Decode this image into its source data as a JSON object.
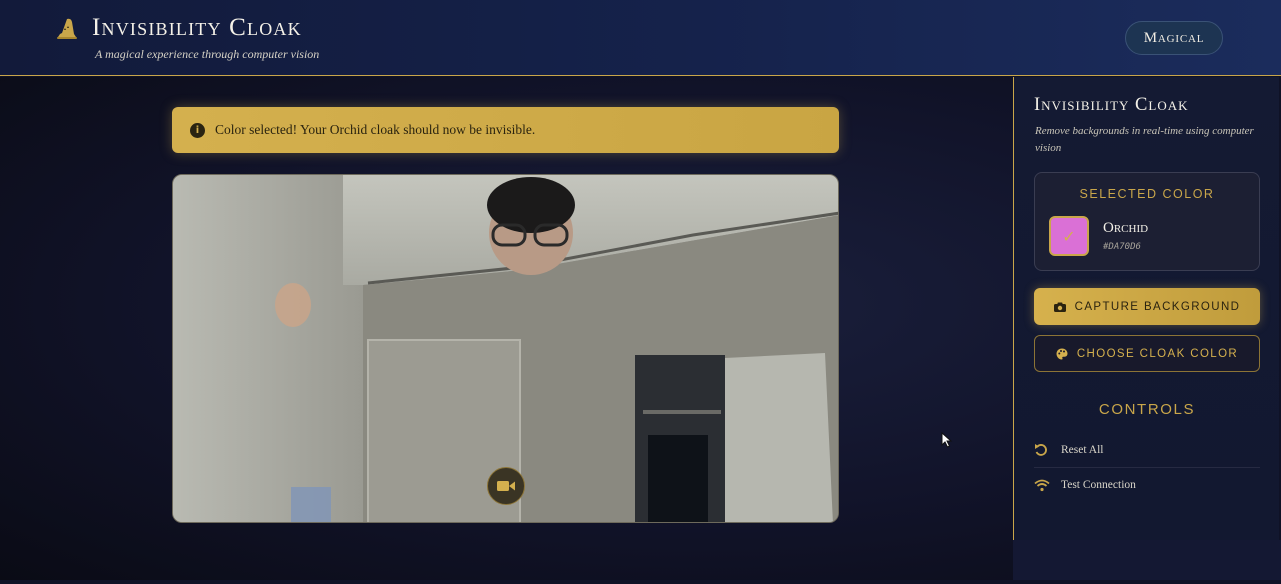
{
  "header": {
    "title": "Invisibility Cloak",
    "subtitle": "A magical experience through computer vision",
    "mode_label": "Magical"
  },
  "alert": {
    "text": "Color selected! Your Orchid cloak should now be invisible."
  },
  "sidebar": {
    "title": "Invisibility Cloak",
    "description": "Remove backgrounds in real-time using computer vision",
    "selected_color": {
      "heading": "SELECTED COLOR",
      "name": "Orchid",
      "hex": "#DA70D6",
      "swatch": "#DA70D6"
    },
    "capture_label": "CAPTURE BACKGROUND",
    "choose_label": "CHOOSE CLOAK COLOR",
    "controls_heading": "CONTROLS",
    "controls": [
      {
        "label": "Reset All",
        "icon": "undo-icon"
      },
      {
        "label": "Test Connection",
        "icon": "wifi-icon"
      }
    ]
  },
  "colors": {
    "accent": "#C9A64A",
    "header_bg": "#15224B",
    "sidebar_bg": "#141A33"
  }
}
